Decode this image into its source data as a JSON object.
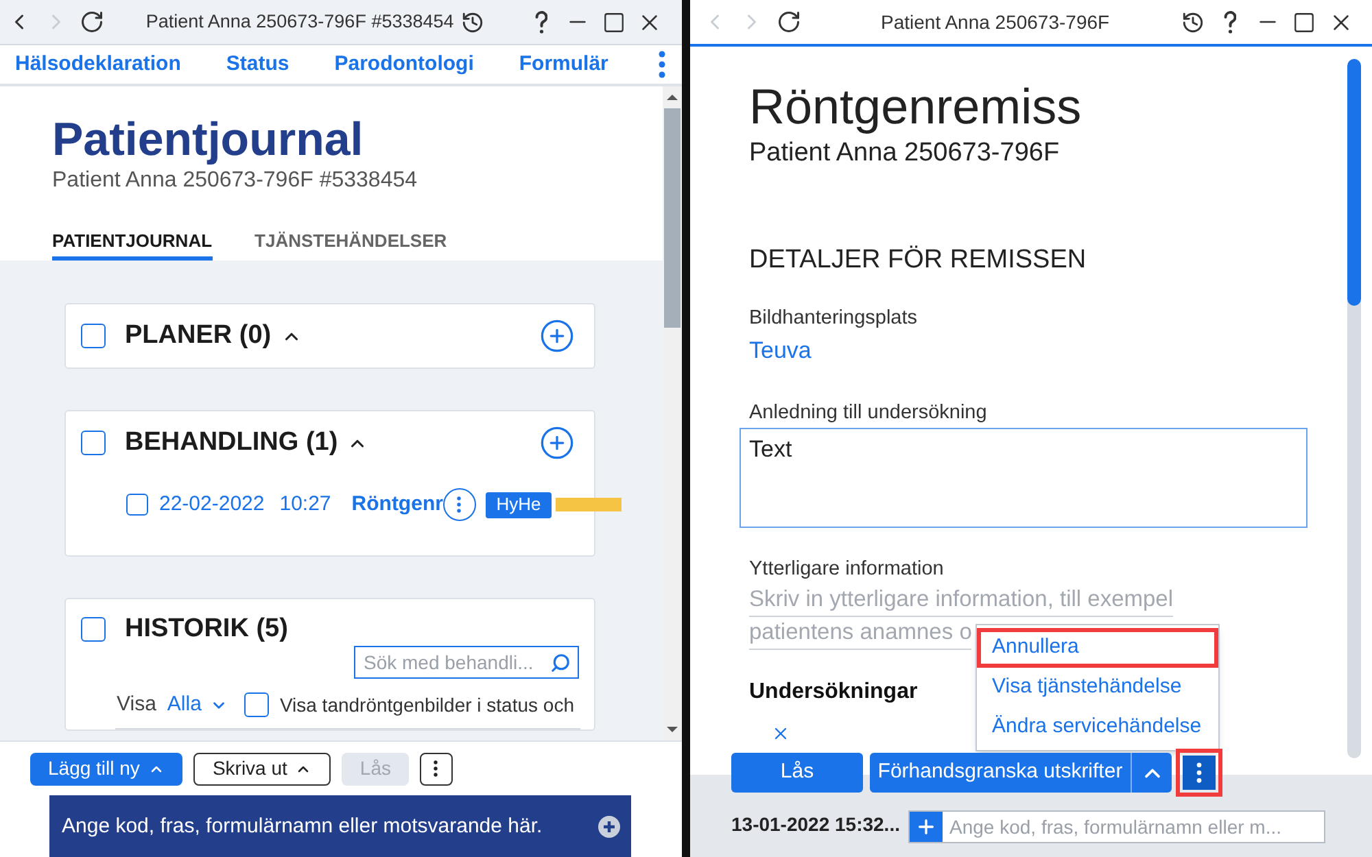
{
  "left_window": {
    "title": "Patient Anna 250673-796F #5338454",
    "nav_buttons": [
      {
        "kind": "back",
        "disabled": false
      },
      {
        "kind": "forward",
        "disabled": true
      },
      {
        "kind": "refresh",
        "disabled": false
      }
    ],
    "menu_links": [
      "Hälsodeklaration",
      "Status",
      "Parodontologi",
      "Formulär"
    ],
    "heading": "Patientjournal",
    "subtitle": "Patient Anna 250673-796F #5338454",
    "tabs": [
      {
        "label": "PATIENTJOURNAL",
        "selected": true
      },
      {
        "label": "TJÄNSTEHÄNDELSER",
        "selected": false
      }
    ],
    "sections": [
      {
        "kind": "plain",
        "title": "PLANER (0)",
        "checked": false,
        "expanded": true
      },
      {
        "kind": "list",
        "title": "BEHANDLING (1)",
        "checked": false,
        "expanded": true,
        "items": [
          {
            "checked": false,
            "date": "22-02-2022",
            "time": "10:27",
            "title": "Röntgenr",
            "badge": "HyHe",
            "color": "#f6c445"
          }
        ]
      },
      {
        "kind": "history",
        "title": "HISTORIK (5)",
        "checked": false,
        "search": {
          "placeholder": "Sök med behandli..."
        },
        "filter": {
          "label": "Visa",
          "value": "Alla",
          "checked": false,
          "checkbox_label": "Visa tandröntgenbilder i status och"
        }
      }
    ],
    "toolbar": [
      {
        "kind": "primary",
        "label": "Lägg till ny",
        "menu": true,
        "disabled": false
      },
      {
        "kind": "outline",
        "label": "Skriva ut",
        "menu": true,
        "disabled": false
      },
      {
        "kind": "primary",
        "label": "Lås",
        "menu": false,
        "disabled": true
      },
      {
        "kind": "more",
        "disabled": false
      }
    ],
    "command": {
      "placeholder": "Ange kod, fras, formulärnamn eller motsvarande här."
    }
  },
  "right_window": {
    "title": "Patient Anna 250673-796F",
    "nav_buttons": [
      {
        "kind": "back",
        "disabled": true
      },
      {
        "kind": "forward",
        "disabled": true
      },
      {
        "kind": "refresh",
        "disabled": false
      }
    ],
    "heading": "Röntgenremiss",
    "subtitle": "Patient Anna 250673-796F",
    "section_title": "DETALJER FÖR REMISSEN",
    "fields": [
      {
        "kind": "link",
        "label": "Bildhanteringsplats",
        "value": "Teuva"
      },
      {
        "kind": "textarea",
        "label": "Anledning till undersökning",
        "value": "Text"
      },
      {
        "kind": "lines",
        "label": "Ytterligare information",
        "placeholder_lines": [
          "Skriv in ytterligare information, till exempel",
          "patientens anamnes o"
        ]
      }
    ],
    "examinations": {
      "title": "Undersökningar"
    },
    "menu": [
      {
        "label": "Annullera",
        "highlighted": true
      },
      {
        "label": "Visa tjänstehändelse",
        "highlighted": false
      },
      {
        "label": "Ändra servicehändelse",
        "highlighted": false
      }
    ],
    "actions": [
      {
        "kind": "primary",
        "label": "Lås"
      },
      {
        "kind": "split",
        "label": "Förhandsgranska utskrifter"
      },
      {
        "kind": "more",
        "highlighted": true
      }
    ],
    "footer": {
      "timestamp": "13-01-2022 15:32...",
      "placeholder": "Ange kod, fras, formulärnamn eller m..."
    }
  }
}
